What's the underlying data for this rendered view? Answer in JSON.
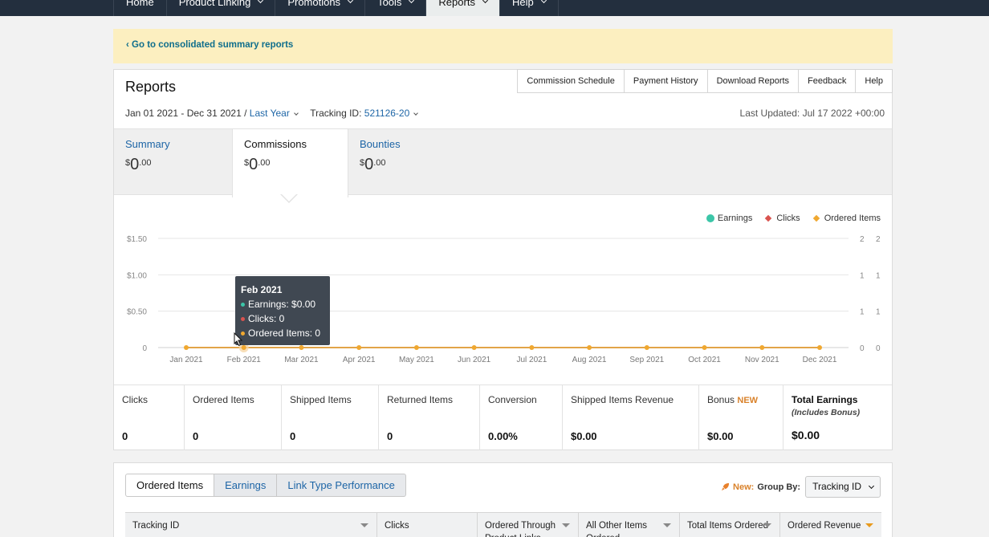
{
  "nav": {
    "items": [
      {
        "label": "Home",
        "dropdown": false,
        "active": false
      },
      {
        "label": "Product Linking",
        "dropdown": true,
        "active": false
      },
      {
        "label": "Promotions",
        "dropdown": true,
        "active": false
      },
      {
        "label": "Tools",
        "dropdown": true,
        "active": false
      },
      {
        "label": "Reports",
        "dropdown": true,
        "active": true
      },
      {
        "label": "Help",
        "dropdown": true,
        "active": false
      }
    ]
  },
  "banner": {
    "link": "‹ Go to consolidated summary reports"
  },
  "reports": {
    "title": "Reports",
    "top_links": [
      "Commission Schedule",
      "Payment History",
      "Download Reports",
      "Feedback",
      "Help"
    ],
    "date_range": "Jan 01 2021 - Dec 31 2021 /",
    "period": "Last Year",
    "tracking_label": "Tracking ID:",
    "tracking_id": "521126-20",
    "last_updated": "Last Updated: Jul 17 2022 +00:00"
  },
  "tabs": [
    {
      "label": "Summary",
      "currency": "$",
      "whole": "0",
      "cents": ".00",
      "active": false
    },
    {
      "label": "Commissions",
      "currency": "$",
      "whole": "0",
      "cents": ".00",
      "active": true
    },
    {
      "label": "Bounties",
      "currency": "$",
      "whole": "0",
      "cents": ".00",
      "active": false
    }
  ],
  "legend": {
    "earnings": "Earnings",
    "clicks": "Clicks",
    "ordered_items": "Ordered Items"
  },
  "colors": {
    "earnings": "#3cc6a8",
    "clicks": "#d9534f",
    "ordered_items": "#f0a830",
    "nav_bg": "#232f3e",
    "link": "#1d65a6",
    "banner": "#fcefc0"
  },
  "chart_data": {
    "type": "line",
    "x": [
      "Jan 2021",
      "Feb 2021",
      "Mar 2021",
      "Apr 2021",
      "May 2021",
      "Jun 2021",
      "Jul 2021",
      "Aug 2021",
      "Sep 2021",
      "Oct 2021",
      "Nov 2021",
      "Dec 2021"
    ],
    "series": [
      {
        "name": "Earnings",
        "values": [
          0,
          0,
          0,
          0,
          0,
          0,
          0,
          0,
          0,
          0,
          0,
          0
        ]
      },
      {
        "name": "Clicks",
        "values": [
          0,
          0,
          0,
          0,
          0,
          0,
          0,
          0,
          0,
          0,
          0,
          0
        ]
      },
      {
        "name": "Ordered Items",
        "values": [
          0,
          0,
          0,
          0,
          0,
          0,
          0,
          0,
          0,
          0,
          0,
          0
        ]
      }
    ],
    "y_ticks_left": [
      "0",
      "$0.50",
      "$1.00",
      "$1.50"
    ],
    "y_ticks_right1": [
      "0",
      "1",
      "1",
      "2"
    ],
    "y_ticks_right2": [
      "0",
      "1",
      "1",
      "2"
    ],
    "ylim": [
      0,
      1.5
    ],
    "grid": true,
    "legend_position": "top-right"
  },
  "tooltip": {
    "title": "Feb 2021",
    "earnings": "Earnings: $0.00",
    "clicks": "Clicks: 0",
    "ordered_items": "Ordered Items: 0"
  },
  "stats": [
    {
      "label": "Clicks",
      "value": "0"
    },
    {
      "label": "Ordered Items",
      "value": "0"
    },
    {
      "label": "Shipped Items",
      "value": "0"
    },
    {
      "label": "Returned Items",
      "value": "0"
    },
    {
      "label": "Conversion",
      "value": "0.00%"
    },
    {
      "label": "Shipped Items Revenue",
      "value": "$0.00"
    },
    {
      "label": "Bonus",
      "badge": "NEW",
      "value": "$0.00"
    },
    {
      "label": "Total Earnings",
      "sub": "(Includes Bonus)",
      "value": "$0.00"
    }
  ],
  "subtabs": [
    "Ordered Items",
    "Earnings",
    "Link Type Performance"
  ],
  "groupby": {
    "new": "New:",
    "label": "Group By:",
    "value": "Tracking ID"
  },
  "table_headers": [
    "Tracking ID",
    "Clicks",
    "Ordered Through Product Links",
    "All Other Items Ordered",
    "Total Items Ordered",
    "Ordered Revenue"
  ]
}
